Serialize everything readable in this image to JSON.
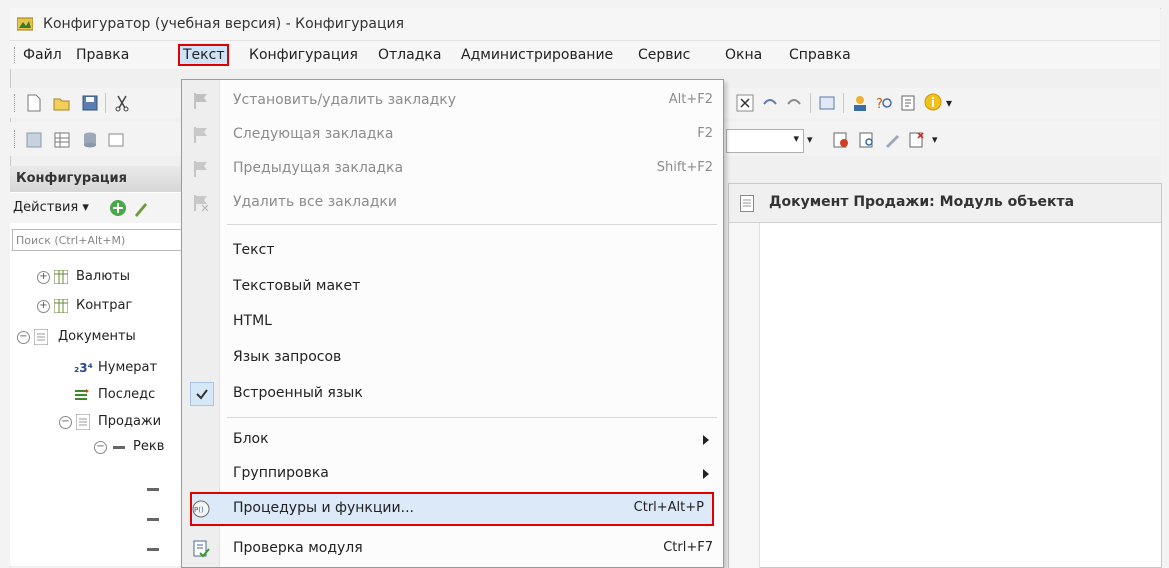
{
  "window": {
    "title": "Конфигуратор (учебная версия) - Конфигурация"
  },
  "menubar": {
    "items": [
      {
        "label": "Файл"
      },
      {
        "label": "Правка"
      },
      {
        "label": "Текст"
      },
      {
        "label": "Конфигурация"
      },
      {
        "label": "Отладка"
      },
      {
        "label": "Администрирование"
      },
      {
        "label": "Сервис"
      },
      {
        "label": "Окна"
      },
      {
        "label": "Справка"
      }
    ]
  },
  "left_panel": {
    "title": "Конфигурация",
    "actions_label": "Действия",
    "search_placeholder": "Поиск (Ctrl+Alt+M)",
    "tree": [
      {
        "label": "Валюты"
      },
      {
        "label": "Контраг"
      },
      {
        "label": "Документы"
      },
      {
        "label": "Нумерат"
      },
      {
        "label": "Последс"
      },
      {
        "label": "Продажи"
      },
      {
        "label": "Рекв"
      }
    ]
  },
  "editor": {
    "title": "Документ Продажи: Модуль объекта"
  },
  "text_menu": {
    "items": [
      {
        "label": "Установить/удалить закладку",
        "shortcut": "Alt+F2"
      },
      {
        "label": "Следующая закладка",
        "shortcut": "F2"
      },
      {
        "label": "Предыдущая закладка",
        "shortcut": "Shift+F2"
      },
      {
        "label": "Удалить все закладки",
        "shortcut": ""
      },
      {
        "label": "Текст",
        "shortcut": ""
      },
      {
        "label": "Текстовый макет",
        "shortcut": ""
      },
      {
        "label": "HTML",
        "shortcut": ""
      },
      {
        "label": "Язык запросов",
        "shortcut": ""
      },
      {
        "label": "Встроенный язык",
        "shortcut": ""
      },
      {
        "label": "Блок",
        "shortcut": ""
      },
      {
        "label": "Группировка",
        "shortcut": ""
      },
      {
        "label": "Процедуры и функции...",
        "shortcut": "Ctrl+Alt+P"
      },
      {
        "label": "Проверка модуля",
        "shortcut": "Ctrl+F7"
      }
    ]
  },
  "colors": {
    "highlight_border": "#e00000",
    "menu_hover": "#dbe9f8"
  }
}
